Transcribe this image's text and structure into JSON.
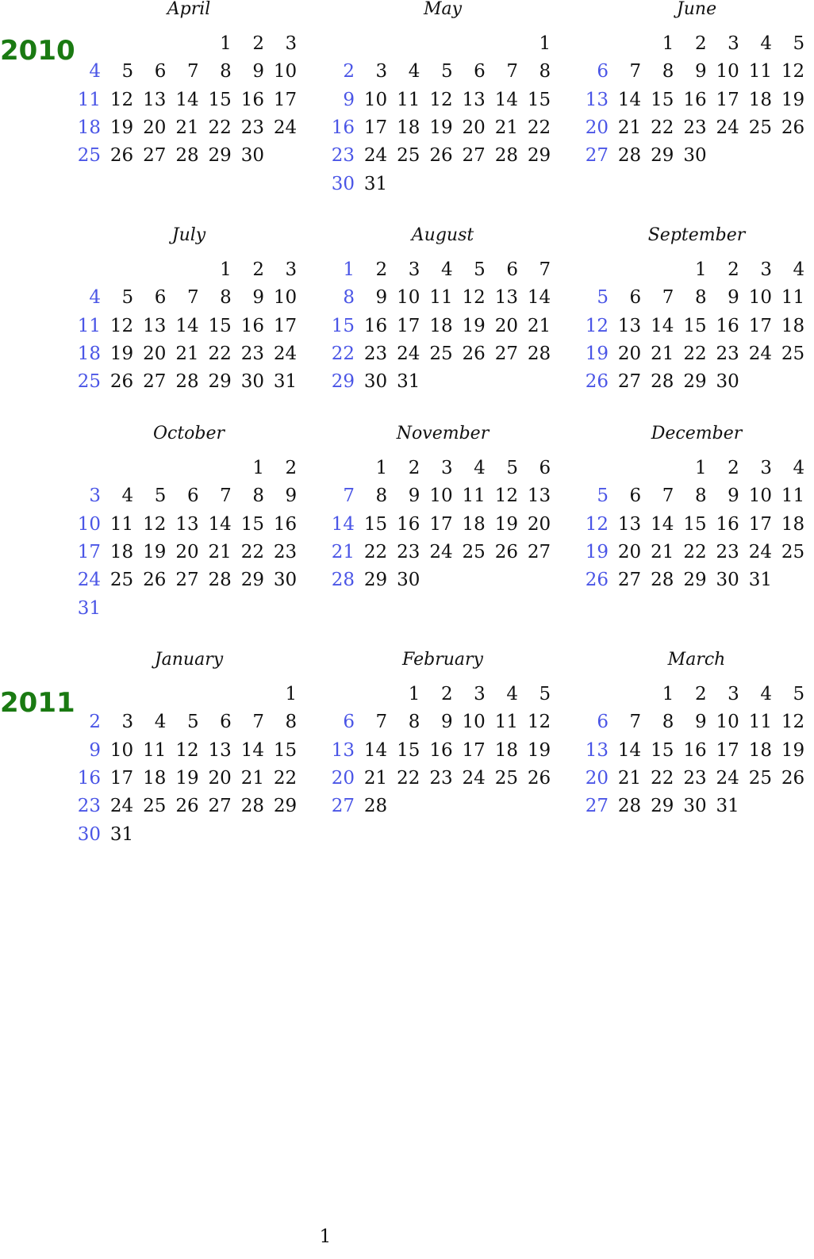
{
  "colors": {
    "year": "#1a7a12",
    "sunday": "#4a55e6",
    "text": "#111111"
  },
  "years": [
    {
      "label": "2010"
    },
    {
      "label": "2011"
    }
  ],
  "months": [
    {
      "name": "April",
      "year_group": 0,
      "start": 4,
      "days": 30
    },
    {
      "name": "May",
      "year_group": 0,
      "start": 6,
      "days": 31
    },
    {
      "name": "June",
      "year_group": 0,
      "start": 2,
      "days": 30
    },
    {
      "name": "July",
      "year_group": 0,
      "start": 4,
      "days": 31
    },
    {
      "name": "August",
      "year_group": 0,
      "start": 0,
      "days": 31
    },
    {
      "name": "September",
      "year_group": 0,
      "start": 3,
      "days": 30
    },
    {
      "name": "October",
      "year_group": 0,
      "start": 5,
      "days": 31
    },
    {
      "name": "November",
      "year_group": 0,
      "start": 1,
      "days": 30
    },
    {
      "name": "December",
      "year_group": 0,
      "start": 3,
      "days": 31
    },
    {
      "name": "January",
      "year_group": 1,
      "start": 6,
      "days": 31
    },
    {
      "name": "February",
      "year_group": 1,
      "start": 2,
      "days": 28
    },
    {
      "name": "March",
      "year_group": 1,
      "start": 2,
      "days": 31
    }
  ],
  "footer": {
    "page_number": "1"
  }
}
